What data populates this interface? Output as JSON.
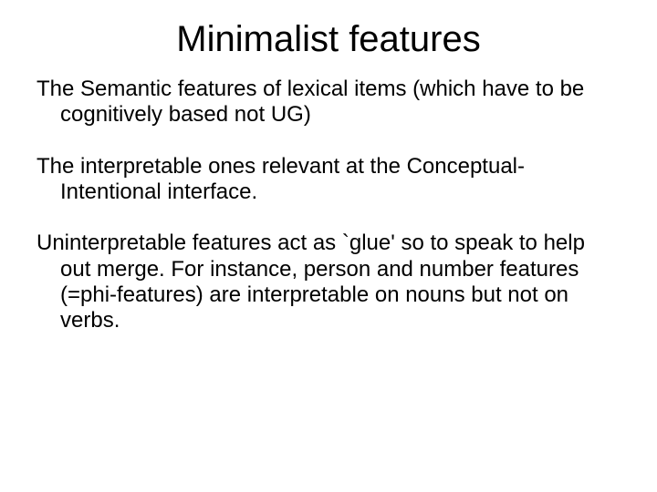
{
  "title": "Minimalist features",
  "paragraphs": [
    "The Semantic features of lexical items (which have to be cognitively based not UG)",
    "The interpretable ones relevant at the Conceptual-Intentional interface.",
    "Uninterpretable features act as `glue' so to speak to help out merge. For instance, person and number features (=phi-features) are interpretable on nouns but not on verbs."
  ]
}
